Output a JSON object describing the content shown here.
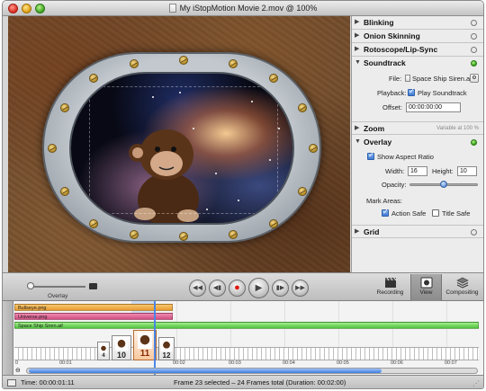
{
  "window": {
    "title": "My iStopMotion Movie 2.mov @ 100%"
  },
  "panel": {
    "sections": {
      "blinking": "Blinking",
      "onion": "Onion Skinning",
      "rotoscope": "Rotoscope/Lip-Sync",
      "soundtrack": "Soundtrack",
      "zoom": "Zoom",
      "zoom_note": "Variable at 100 %",
      "overlay": "Overlay",
      "grid": "Grid"
    },
    "soundtrack": {
      "file_label": "File:",
      "file_value": "Space Ship Siren.aif",
      "playback_label": "Playback:",
      "play_soundtrack": "Play Soundtrack",
      "offset_label": "Offset:",
      "offset_value": "00:00:00:00"
    },
    "overlay": {
      "show_aspect": "Show Aspect Ratio",
      "width_label": "Width:",
      "width_value": "16",
      "height_label": "Height:",
      "height_value": "10",
      "opacity_label": "Opacity:",
      "opacity_level": 0.5,
      "mark_areas": "Mark Areas:",
      "action_safe": "Action Safe",
      "title_safe": "Title Safe"
    }
  },
  "controls": {
    "overlay_label": "Overlay",
    "modes": {
      "recording": "Recording",
      "view": "View",
      "compositing": "Compositing"
    }
  },
  "timeline": {
    "tracks": {
      "bullseye": "Bullseye.png",
      "universe": "Universe.png",
      "siren": "Space Ship Siren.aif"
    },
    "frames": [
      "4",
      "",
      "10",
      "11",
      "12"
    ],
    "ruler": [
      "00:01",
      "00:02",
      "00:03",
      "00:04",
      "00:05",
      "00:06",
      "00:07"
    ],
    "ruler_start": "0"
  },
  "status": {
    "time_label": "Time: 00:00:01:11",
    "frame_info": "Frame 23 selected – 24 Frames total (Duration: 00:02:00)"
  },
  "colors": {
    "accent": "#3f79d4",
    "record": "#e0180e",
    "active_green": "#2f9b14"
  }
}
